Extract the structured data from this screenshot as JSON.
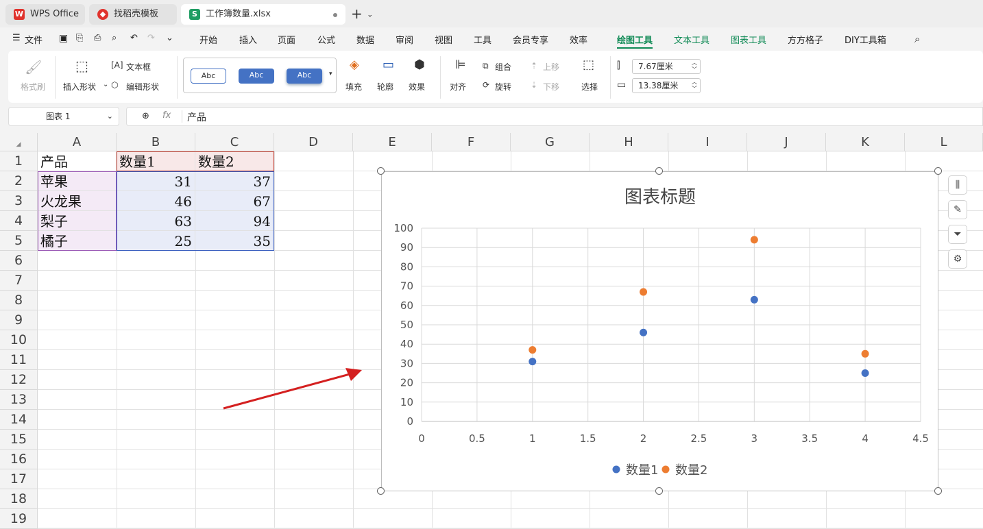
{
  "tabs": [
    {
      "label": "WPS Office",
      "icon": "wps-logo-icon"
    },
    {
      "label": "找稻壳模板",
      "icon": "docer-icon"
    },
    {
      "label": "工作簿数量.xlsx",
      "icon": "spreadsheet-icon"
    }
  ],
  "menubar": {
    "file": "文件",
    "items": [
      "开始",
      "插入",
      "页面",
      "公式",
      "数据",
      "审阅",
      "视图",
      "工具",
      "会员专享",
      "效率",
      "绘图工具",
      "文本工具",
      "图表工具",
      "方方格子",
      "DIY工具箱"
    ],
    "active": "绘图工具"
  },
  "ribbon": {
    "format_painter": "格式刷",
    "insert_shape": "插入形状",
    "text_box": "文本框",
    "edit_shape": "编辑形状",
    "style_samples": [
      "Abc",
      "Abc",
      "Abc"
    ],
    "fill": "填充",
    "outline": "轮廓",
    "effect": "效果",
    "align": "对齐",
    "group": "组合",
    "rotate": "旋转",
    "move_up": "上移",
    "move_down": "下移",
    "select": "选择",
    "height": "7.67厘米",
    "width": "13.38厘米",
    "accent_color": "#0f8a55"
  },
  "formula_bar": {
    "name_box": "图表 1",
    "fx": "fx",
    "content": "产品"
  },
  "sheet": {
    "columns": [
      "A",
      "B",
      "C",
      "D",
      "E",
      "F",
      "G",
      "H",
      "I",
      "J",
      "K",
      "L"
    ],
    "rows": [
      "1",
      "2",
      "3",
      "4",
      "5",
      "6",
      "7",
      "8",
      "9",
      "10",
      "11",
      "12",
      "13",
      "14",
      "15",
      "16",
      "17",
      "18",
      "19"
    ],
    "header": [
      "产品",
      "数量1",
      "数量2"
    ],
    "data": [
      [
        "苹果",
        "31",
        "37"
      ],
      [
        "火龙果",
        "46",
        "67"
      ],
      [
        "梨子",
        "63",
        "94"
      ],
      [
        "橘子",
        "25",
        "35"
      ]
    ]
  },
  "chart_data": {
    "type": "scatter",
    "title": "图表标题",
    "xlim": [
      0,
      4.5
    ],
    "ylim": [
      0,
      100
    ],
    "x_ticks": [
      "0",
      "0.5",
      "1",
      "1.5",
      "2",
      "2.5",
      "3",
      "3.5",
      "4",
      "4.5"
    ],
    "y_ticks": [
      "0",
      "10",
      "20",
      "30",
      "40",
      "50",
      "60",
      "70",
      "80",
      "90",
      "100"
    ],
    "grid": true,
    "legend": "bottom",
    "series": [
      {
        "name": "数量1",
        "color": "#4472c4",
        "points": [
          [
            1,
            31
          ],
          [
            2,
            46
          ],
          [
            3,
            63
          ],
          [
            4,
            25
          ]
        ]
      },
      {
        "name": "数量2",
        "color": "#ed7d31",
        "points": [
          [
            1,
            37
          ],
          [
            2,
            67
          ],
          [
            3,
            94
          ],
          [
            4,
            35
          ]
        ]
      }
    ]
  },
  "annotation": {
    "arrow_color": "#d42020"
  }
}
